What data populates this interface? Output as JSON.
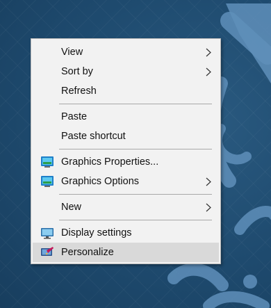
{
  "desktop": {
    "background_color": "#1e4a6e",
    "accent_color": "#6f9dc4"
  },
  "context_menu": {
    "groups": [
      {
        "items": [
          {
            "label": "View",
            "has_submenu": true
          },
          {
            "label": "Sort by",
            "has_submenu": true
          },
          {
            "label": "Refresh",
            "has_submenu": false
          }
        ]
      },
      {
        "items": [
          {
            "label": "Paste",
            "has_submenu": false
          },
          {
            "label": "Paste shortcut",
            "has_submenu": false
          }
        ]
      },
      {
        "items": [
          {
            "label": "Graphics Properties...",
            "icon": "intel-graphics-icon",
            "has_submenu": false
          },
          {
            "label": "Graphics Options",
            "icon": "intel-graphics-icon",
            "has_submenu": true
          }
        ]
      },
      {
        "items": [
          {
            "label": "New",
            "has_submenu": true
          }
        ]
      },
      {
        "items": [
          {
            "label": "Display settings",
            "icon": "display-monitor-icon",
            "has_submenu": false
          },
          {
            "label": "Personalize",
            "icon": "personalize-icon",
            "has_submenu": false,
            "highlighted": true
          }
        ]
      }
    ]
  }
}
